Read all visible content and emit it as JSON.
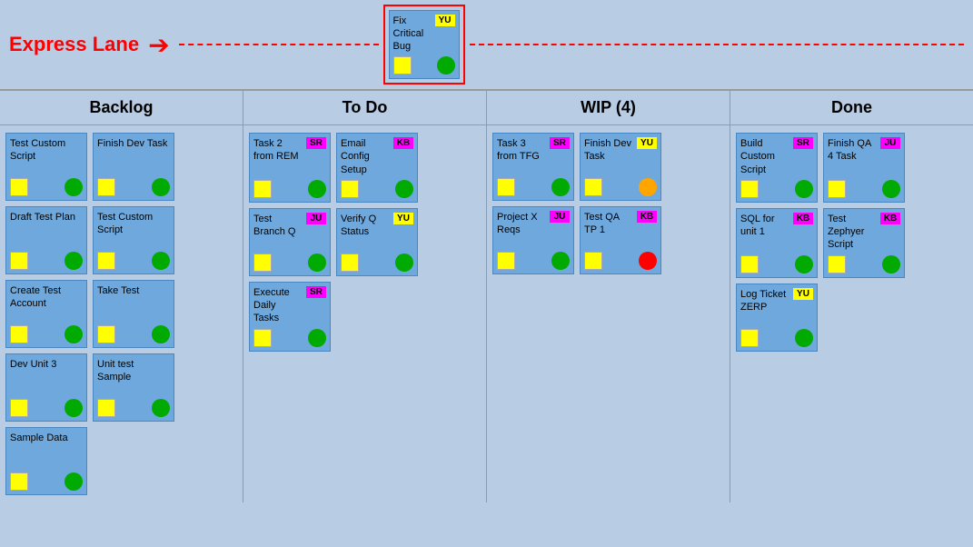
{
  "expresslane": {
    "title": "Express Lane",
    "card": {
      "title": "Fix Critical Bug",
      "badge": "YU",
      "badge_class": "badge-yellow",
      "circle_class": "circle-green"
    }
  },
  "columns": [
    {
      "header": "Backlog",
      "cards": [
        {
          "title": "Test Custom Script",
          "badge": "",
          "badge_class": "",
          "circle_class": "circle-green"
        },
        {
          "title": "Finish Dev Task",
          "badge": "",
          "badge_class": "",
          "circle_class": "circle-green"
        },
        {
          "title": "Draft Test Plan",
          "badge": "",
          "badge_class": "",
          "circle_class": "circle-green"
        },
        {
          "title": "Test Custom Script",
          "badge": "",
          "badge_class": "",
          "circle_class": "circle-green"
        },
        {
          "title": "Create Test Account",
          "badge": "",
          "badge_class": "",
          "circle_class": "circle-green"
        },
        {
          "title": "Take Test",
          "badge": "",
          "badge_class": "",
          "circle_class": "circle-green"
        },
        {
          "title": "Dev Unit 3",
          "badge": "",
          "badge_class": "",
          "circle_class": "circle-green"
        },
        {
          "title": "Unit test Sample",
          "badge": "",
          "badge_class": "",
          "circle_class": "circle-green"
        },
        {
          "title": "Sample Data",
          "badge": "",
          "badge_class": "",
          "circle_class": "circle-green"
        }
      ]
    },
    {
      "header": "To Do",
      "cards": [
        {
          "title": "Task 2 from REM",
          "badge": "SR",
          "badge_class": "badge-magenta",
          "circle_class": "circle-green"
        },
        {
          "title": "Email Config Setup",
          "badge": "KB",
          "badge_class": "badge-magenta",
          "circle_class": "circle-green"
        },
        {
          "title": "Test Branch Q",
          "badge": "JU",
          "badge_class": "badge-magenta",
          "circle_class": "circle-green"
        },
        {
          "title": "Verify Q Status",
          "badge": "YU",
          "badge_class": "badge-yellow",
          "circle_class": "circle-green"
        },
        {
          "title": "Execute Daily Tasks",
          "badge": "SR",
          "badge_class": "badge-magenta",
          "circle_class": "circle-green"
        }
      ]
    },
    {
      "header": "WIP (4)",
      "cards": [
        {
          "title": "Task 3 from TFG",
          "badge": "SR",
          "badge_class": "badge-magenta",
          "circle_class": "circle-green"
        },
        {
          "title": "Finish Dev Task",
          "badge": "YU",
          "badge_class": "badge-yellow",
          "circle_class": "circle-orange"
        },
        {
          "title": "Project X Reqs",
          "badge": "JU",
          "badge_class": "badge-magenta",
          "circle_class": "circle-green"
        },
        {
          "title": "Test QA TP 1",
          "badge": "KB",
          "badge_class": "badge-magenta",
          "circle_class": "circle-red"
        }
      ]
    },
    {
      "header": "Done",
      "cards": [
        {
          "title": "Build Custom Script",
          "badge": "SR",
          "badge_class": "badge-magenta",
          "circle_class": "circle-green"
        },
        {
          "title": "Finish QA 4 Task",
          "badge": "JU",
          "badge_class": "badge-magenta",
          "circle_class": "circle-green"
        },
        {
          "title": "SQL for unit 1",
          "badge": "KB",
          "badge_class": "badge-magenta",
          "circle_class": "circle-green"
        },
        {
          "title": "Test Zephyer Script",
          "badge": "KB",
          "badge_class": "badge-magenta",
          "circle_class": "circle-green"
        },
        {
          "title": "Log Ticket ZERP",
          "badge": "YU",
          "badge_class": "badge-yellow",
          "circle_class": "circle-green"
        }
      ]
    }
  ]
}
